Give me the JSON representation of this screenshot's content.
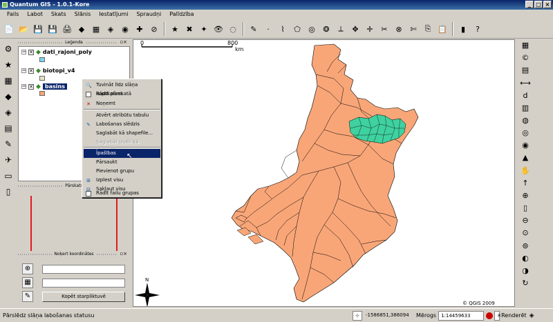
{
  "window": {
    "title": "Quantum GIS - 1.0.1-Kore",
    "min": "_",
    "max": "□",
    "close": "×"
  },
  "menu": [
    "Fails",
    "Labot",
    "Skats",
    "Slānis",
    "Iestatījumi",
    "Spraudņi",
    "Palīdzība"
  ],
  "legend": {
    "title": "Leģenda",
    "layers": [
      {
        "name": "dati_rajoni_poly"
      },
      {
        "name": "biotopi_v4"
      },
      {
        "name": "basins"
      }
    ],
    "panel_buttons": "▫×"
  },
  "overview": {
    "title": "Pārskats"
  },
  "coords": {
    "title": "Noķert koordinātes",
    "copy_label": "Kopēt starpliktuvē",
    "x_value": "",
    "y_value": ""
  },
  "context_menu": {
    "items": [
      {
        "label": "Tuvināt līdz slāņa kopskatam",
        "icon": "zoom-extent-icon"
      },
      {
        "label": "Rādīt pārskatā",
        "icon": "checkbox-icon"
      },
      {
        "label": "Noņemt",
        "icon": "remove-icon"
      },
      {
        "label": "Atvērt atribūtu tabulu",
        "icon": ""
      },
      {
        "label": "Labošanas slēdzis",
        "icon": "pencil-icon"
      },
      {
        "label": "Saglabāt kā shapefile...",
        "icon": ""
      },
      {
        "label": "Saglabāt izvēli kā shapefile...",
        "icon": ""
      },
      {
        "label": "Īpašības",
        "icon": ""
      },
      {
        "label": "Pārsaukt",
        "icon": ""
      },
      {
        "label": "Pievienot grupu",
        "icon": ""
      },
      {
        "label": "Izplest visu",
        "icon": "expand-icon"
      },
      {
        "label": "Sakļaut visu",
        "icon": "collapse-icon"
      },
      {
        "label": "Rādīt failu grupas",
        "icon": "checkbox-icon"
      }
    ]
  },
  "map": {
    "scale_start": "0",
    "scale_end": "800",
    "scale_unit": "km",
    "copyright": "© QGIS 2009",
    "north": "N"
  },
  "status": {
    "text": "Pārslēdz slāņa labošanas statusu",
    "coordinates": "-1586851,386094",
    "scale_label": "Mērogs",
    "scale_value": "1:14459633",
    "render_label": "Renderēt"
  },
  "colors": {
    "basin_fill": "#f8a678",
    "selected_fill": "#3fd1a0",
    "menu_highlight": "#0a246a"
  }
}
